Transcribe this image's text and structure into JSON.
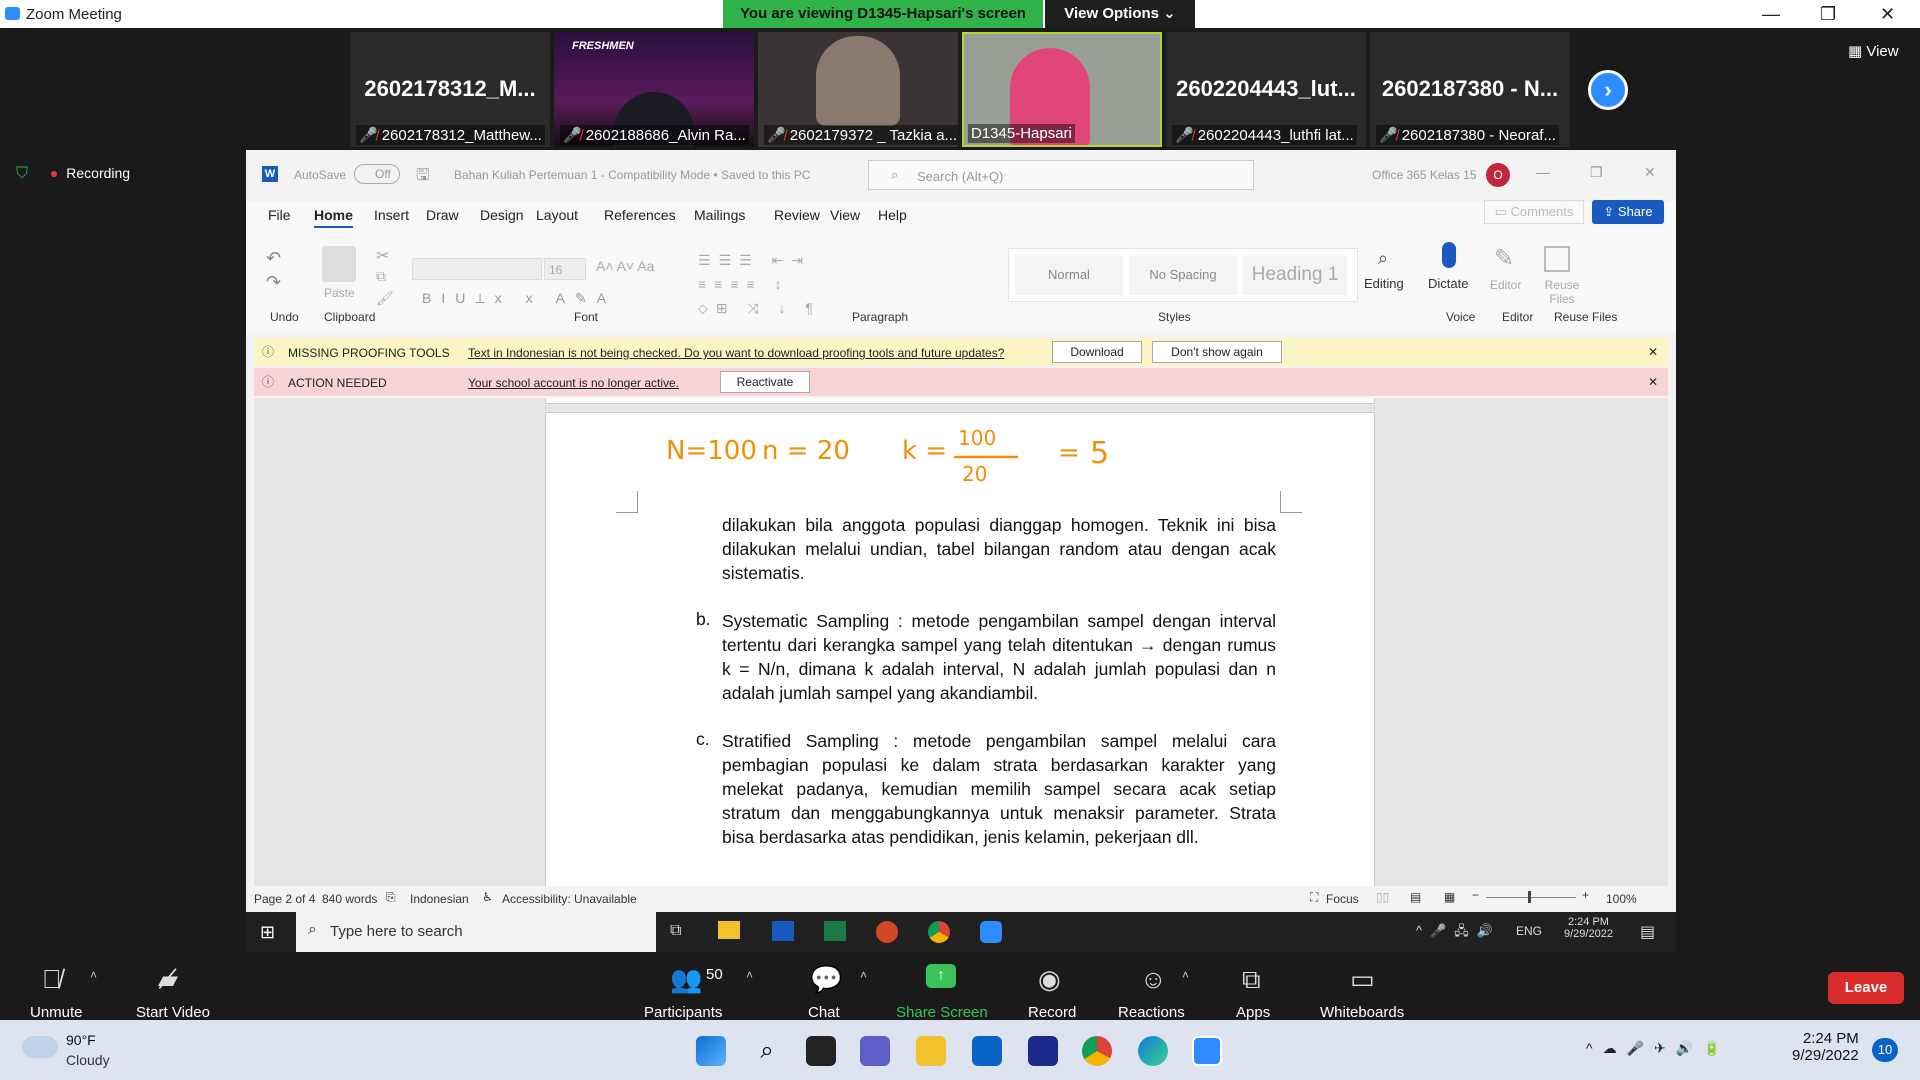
{
  "window": {
    "title": "Zoom Meeting",
    "viewing_banner": "You are viewing D1345-Hapsari's screen",
    "view_options": "View Options"
  },
  "gallery": {
    "view_label": "View",
    "tiles": [
      {
        "name_big": "2602178312_M...",
        "label": "2602178312_Matthew..."
      },
      {
        "name_big": "",
        "label": "2602188686_Alvin Ra..."
      },
      {
        "name_big": "",
        "label": "2602179372 _ Tazkia a..."
      },
      {
        "name_big": "",
        "label": "D1345-Hapsari"
      },
      {
        "name_big": "2602204443_lut...",
        "label": "2602204443_luthfi lat..."
      },
      {
        "name_big": "2602187380 - N...",
        "label": "2602187380 - Neoraf..."
      }
    ],
    "tile2_banner": "FRESHMEN"
  },
  "recording": "Recording",
  "word": {
    "autosave": "AutoSave",
    "autosave_state": "Off",
    "doc_title": "Bahan Kuliah Pertemuan 1  -  Compatibility Mode • Saved to this PC",
    "search_placeholder": "Search (Alt+Q)",
    "account": "Office 365 Kelas 15",
    "avatar_letter": "O",
    "tabs": [
      "File",
      "Home",
      "Insert",
      "Draw",
      "Design",
      "Layout",
      "References",
      "Mailings",
      "Review",
      "View",
      "Help"
    ],
    "comments": "Comments",
    "share": "Share",
    "groups": [
      "Undo",
      "Clipboard",
      "Font",
      "Paragraph",
      "Styles",
      "Voice",
      "Editor",
      "Reuse Files"
    ],
    "paste": "Paste",
    "font_size": "16",
    "styles": [
      "Normal",
      "No Spacing",
      "Heading 1"
    ],
    "editing": "Editing",
    "dictate": "Dictate",
    "editor": "Editor",
    "reuse_files": "Reuse Files",
    "proof_bar": {
      "title": "MISSING PROOFING TOOLS",
      "message": "Text in Indonesian is not being checked. Do you want to download proofing tools and future updates?",
      "download": "Download",
      "dont_show": "Don't show again"
    },
    "action_bar": {
      "title": "ACTION NEEDED",
      "message": "Your school account is no longer active.",
      "reactivate": "Reactivate"
    },
    "handwriting": "N=100   n = 20   k = 100/20 = 5",
    "handwriting_parts": {
      "n1": "N=100",
      "n2": "n = 20",
      "k": "k =",
      "num": "100",
      "den": "20",
      "eq": "=",
      "res": "5"
    },
    "paragraphs": [
      {
        "marker": "",
        "text": "dilakukan bila anggota populasi dianggap homogen. Teknik ini bisa dilakukan melalui undian, tabel bilangan random atau dengan acak sistematis."
      },
      {
        "marker": "b.",
        "text": "Systematic Sampling : metode pengambilan sampel dengan interval tertentu dari kerangka sampel yang telah ditentukan → dengan rumus k = N/n, dimana k adalah interval, N adalah jumlah populasi dan n adalah jumlah sampel yang akandiambil."
      },
      {
        "marker": "c.",
        "text": "Stratified Sampling : metode pengambilan sampel melalui cara pembagian populasi ke dalam strata berdasarkan karakter yang melekat padanya, kemudian memilih sampel secara acak setiap stratum dan menggabungkannya untuk menaksir parameter. Strata bisa berdasarka atas pendidikan, jenis kelamin, pekerjaan dll."
      }
    ],
    "status": {
      "page": "Page 2 of 4",
      "words": "840 words",
      "language": "Indonesian",
      "accessibility": "Accessibility: Unavailable",
      "focus": "Focus",
      "zoom": "100%"
    }
  },
  "inner_taskbar": {
    "search": "Type here to search",
    "lang": "ENG",
    "time": "2:24 PM",
    "date": "9/29/2022"
  },
  "zoom_controls": {
    "unmute": "Unmute",
    "start_video": "Start Video",
    "participants_count": "50",
    "participants": "Participants",
    "chat": "Chat",
    "share_screen": "Share Screen",
    "record": "Record",
    "reactions": "Reactions",
    "apps": "Apps",
    "whiteboards": "Whiteboards",
    "leave": "Leave"
  },
  "win_taskbar": {
    "temp": "90°F",
    "weather": "Cloudy",
    "time": "2:24 PM",
    "date": "9/29/2022",
    "notif": "10"
  },
  "colors": {
    "zoom_blue": "#2d8cff",
    "viewing_green": "#2fb34a",
    "share_green": "#3ac35a",
    "leave_red": "#d92c2c",
    "word_blue": "#185abd",
    "ink_orange": "#f0900a"
  }
}
